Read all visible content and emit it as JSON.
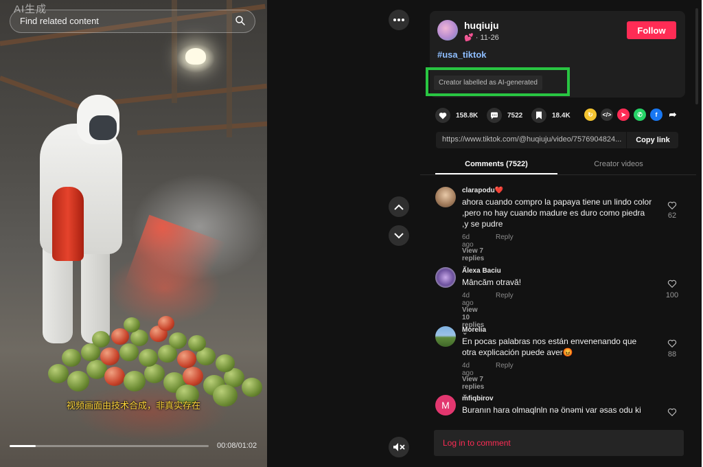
{
  "video": {
    "watermark": "AI生成",
    "search_placeholder": "Find related content",
    "subtitle": "视频画面由技术合成，非真实存在",
    "progress": 0.13,
    "time": "00:08/01:02"
  },
  "post": {
    "username": "huqiuju",
    "date_line": "· 11-26",
    "follow_label": "Follow",
    "hashtag": "#usa_tiktok",
    "ai_label": "Creator labelled as AI-generated",
    "likes": "158.8K",
    "comments": "7522",
    "saves": "18.4K",
    "link": "https://www.tiktok.com/@huqiuju/video/7576904824...",
    "copy_label": "Copy link"
  },
  "tabs": {
    "comments": "Comments (7522)",
    "creator": "Creator videos"
  },
  "comments": [
    {
      "name": "clarapodu❤️",
      "text": "ahora cuando compro la papaya tiene un lindo color ,pero no hay cuando madure es duro como piedra ,y se pudre",
      "age": "6d ago",
      "reply": "Reply",
      "view": "View 7 replies",
      "likes": "62"
    },
    {
      "name": "Alexa Baciu",
      "text": "Mâncăm otravă!",
      "age": "4d ago",
      "reply": "Reply",
      "view": "View 10 replies",
      "likes": "100"
    },
    {
      "name": "Morelia",
      "text": "En pocas palabras nos están envenenando que otra explicación puede aver😡",
      "age": "4d ago",
      "reply": "Reply",
      "view": "View 7 replies",
      "likes": "88"
    },
    {
      "name": "mfiqbirov",
      "initial": "M",
      "text": "Buranın hara olmaqlnln nə önəmi var əsas odu ki"
    }
  ],
  "login_prompt": "Log in to comment",
  "colors": {
    "accent": "#fe2c55",
    "ai_highlight": "#29c542",
    "hashtag": "#8ebeff"
  }
}
